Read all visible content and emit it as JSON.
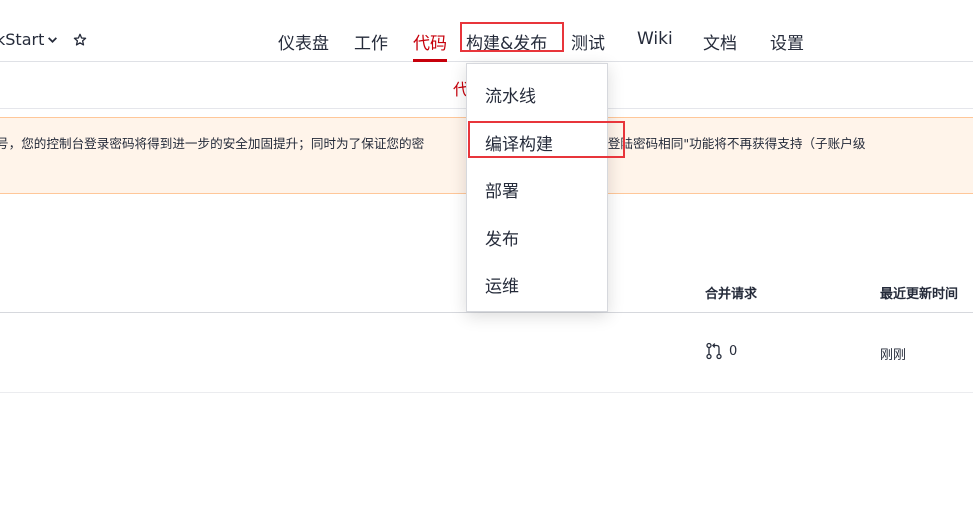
{
  "topbar": {
    "project_name": "kStart",
    "nav": [
      {
        "label": "仪表盘"
      },
      {
        "label": "工作"
      },
      {
        "label": "代码"
      },
      {
        "label": "构建&发布"
      },
      {
        "label": "测试"
      },
      {
        "label": "Wiki"
      },
      {
        "label": "文档"
      },
      {
        "label": "设置"
      }
    ]
  },
  "subnav": {
    "active_tab": "代码"
  },
  "notice": {
    "text_left": "号，您的控制台登录密码将得到进一步的安全加固提升；同时为了保证您的密",
    "text_right": "置为与华为云登陆密码相同\"功能将不再获得支持（子账户级"
  },
  "table": {
    "headers": {
      "merge_requests": "合并请求",
      "last_updated": "最近更新时间"
    },
    "row": {
      "merge_count": "0",
      "updated": "刚刚"
    }
  },
  "dropdown": {
    "items": [
      {
        "label": "流水线"
      },
      {
        "label": "编译构建"
      },
      {
        "label": "部署"
      },
      {
        "label": "发布"
      },
      {
        "label": "运维"
      }
    ]
  },
  "colors": {
    "accent": "#c7000b",
    "highlight": "#e8353b",
    "notice_bg": "#fff4ea"
  }
}
